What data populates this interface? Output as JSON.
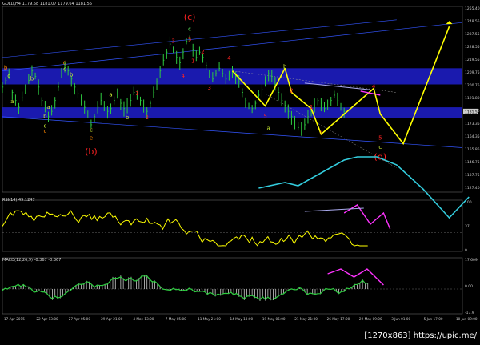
{
  "header": {
    "symbol_line": "GOLD,H4  1179.58 1181.07 1179.64 1181.55"
  },
  "rsi_label": "RSI(14) 49.1247",
  "macd_label": "MACD(12,26,9) -0.367 -0.367",
  "watermark": "[1270x863] https://upic.me/",
  "colors": {
    "background": "#000000",
    "price_bars": "#2ecc40",
    "rsi_line": "#ffff00",
    "macd_line": "#2ecc40",
    "zone": "#1e1ecc",
    "projection_yellow": "#ffff00",
    "projection_cyan": "#33ccdd",
    "projection_magenta": "#ff33ff",
    "wave_orange": "#ff8800",
    "wave_red": "#ff2222",
    "wave_yellow_green": "#ccee33",
    "wave_green": "#66ff66"
  },
  "chart_data": [
    {
      "type": "line",
      "panel": "price",
      "title": "",
      "y_ticks": [
        "1255.40",
        "1248.55",
        "1237.55",
        "1228.55",
        "1219.55",
        "1209.75",
        "1200.75",
        "1191.80",
        "1182.35",
        "1173.35",
        "1164.35",
        "1155.85",
        "1146.75",
        "1137.75",
        "1127.40"
      ],
      "current_price_label": "1181.55",
      "x_ticks": [
        "17 Apr 2015",
        "22 Apr 13:00",
        "27 Apr 05:00",
        "29 Apr 21:00",
        "4 May 13:00",
        "7 May 05:00",
        "11 May 21:00",
        "14 May 13:00",
        "19 May 05:00",
        "21 May 21:00",
        "26 May 17:00",
        "29 May 09:00",
        "3 Jun 01:00",
        "5 Jun 17:00",
        "10 Jun 09:00"
      ],
      "wave_labels": [
        {
          "text": "b",
          "color_key": "wave_orange",
          "xv": 1,
          "yv": 1213
        },
        {
          "text": "c",
          "color_key": "wave_yellow_green",
          "xv": 2,
          "yv": 1207
        },
        {
          "text": "b",
          "color_key": "wave_yellow_green",
          "xv": 9,
          "yv": 1205
        },
        {
          "text": "a",
          "color_key": "wave_yellow_green",
          "xv": 3,
          "yv": 1188
        },
        {
          "text": "d",
          "color_key": "wave_orange",
          "xv": 19,
          "yv": 1217
        },
        {
          "text": "c",
          "color_key": "wave_yellow_green",
          "xv": 19,
          "yv": 1212
        },
        {
          "text": "b",
          "color_key": "wave_yellow_green",
          "xv": 21,
          "yv": 1208
        },
        {
          "text": "a",
          "color_key": "wave_yellow_green",
          "xv": 33,
          "yv": 1193
        },
        {
          "text": "a",
          "color_key": "wave_yellow_green",
          "xv": 14,
          "yv": 1184
        },
        {
          "text": "b",
          "color_key": "wave_yellow_green",
          "xv": 13,
          "yv": 1177
        },
        {
          "text": "c",
          "color_key": "wave_yellow_green",
          "xv": 13,
          "yv": 1170
        },
        {
          "text": "c",
          "color_key": "wave_orange",
          "xv": 13,
          "yv": 1166
        },
        {
          "text": "b",
          "color_key": "wave_yellow_green",
          "xv": 38,
          "yv": 1176
        },
        {
          "text": "c",
          "color_key": "wave_yellow_green",
          "xv": 27,
          "yv": 1167
        },
        {
          "text": "e",
          "color_key": "wave_orange",
          "xv": 27,
          "yv": 1161
        },
        {
          "text": "(b)",
          "color_key": "wave_red",
          "xv": 27,
          "yv": 1150
        },
        {
          "text": "1",
          "color_key": "wave_red",
          "xv": 41,
          "yv": 1194
        },
        {
          "text": "2",
          "color_key": "wave_red",
          "xv": 44,
          "yv": 1176
        },
        {
          "text": "3",
          "color_key": "wave_red",
          "xv": 52,
          "yv": 1233
        },
        {
          "text": "4",
          "color_key": "wave_red",
          "xv": 55,
          "yv": 1207
        },
        {
          "text": "5",
          "color_key": "wave_red",
          "xv": 57,
          "yv": 1234
        },
        {
          "text": "1",
          "color_key": "wave_red",
          "xv": 58,
          "yv": 1218
        },
        {
          "text": "2",
          "color_key": "wave_red",
          "xv": 61,
          "yv": 1225
        },
        {
          "text": "c",
          "color_key": "wave_green",
          "xv": 57,
          "yv": 1242
        },
        {
          "text": "(c)",
          "color_key": "wave_red",
          "xv": 57,
          "yv": 1250
        },
        {
          "text": "3",
          "color_key": "wave_red",
          "xv": 63,
          "yv": 1198
        },
        {
          "text": "4",
          "color_key": "wave_red",
          "xv": 69,
          "yv": 1220
        },
        {
          "text": "b",
          "color_key": "wave_yellow_green",
          "xv": 86,
          "yv": 1214
        },
        {
          "text": "2",
          "color_key": "wave_red",
          "xv": 88,
          "yv": 1196
        },
        {
          "text": "5",
          "color_key": "wave_red",
          "xv": 80,
          "yv": 1177
        },
        {
          "text": "a",
          "color_key": "wave_yellow_green",
          "xv": 81,
          "yv": 1168
        },
        {
          "text": "1",
          "color_key": "wave_red",
          "xv": 94,
          "yv": 1184
        },
        {
          "text": "3",
          "color_key": "wave_red",
          "xv": 97,
          "yv": 1165
        },
        {
          "text": "4",
          "color_key": "wave_red",
          "xv": 113,
          "yv": 1199
        },
        {
          "text": "5",
          "color_key": "wave_red",
          "xv": 115,
          "yv": 1161
        },
        {
          "text": "c",
          "color_key": "wave_yellow_green",
          "xv": 115,
          "yv": 1154
        },
        {
          "text": "(d)",
          "color_key": "wave_red",
          "xv": 115,
          "yv": 1146
        }
      ]
    },
    {
      "type": "line",
      "panel": "rsi",
      "title": "RSI(14) 49.1247",
      "y_ticks": [
        "100",
        "37",
        "0"
      ]
    },
    {
      "type": "line",
      "panel": "macd",
      "title": "MACD(12,26,9) -0.367 -0.367",
      "y_ticks": [
        "17.609",
        "0.00",
        "-17.9"
      ]
    }
  ]
}
